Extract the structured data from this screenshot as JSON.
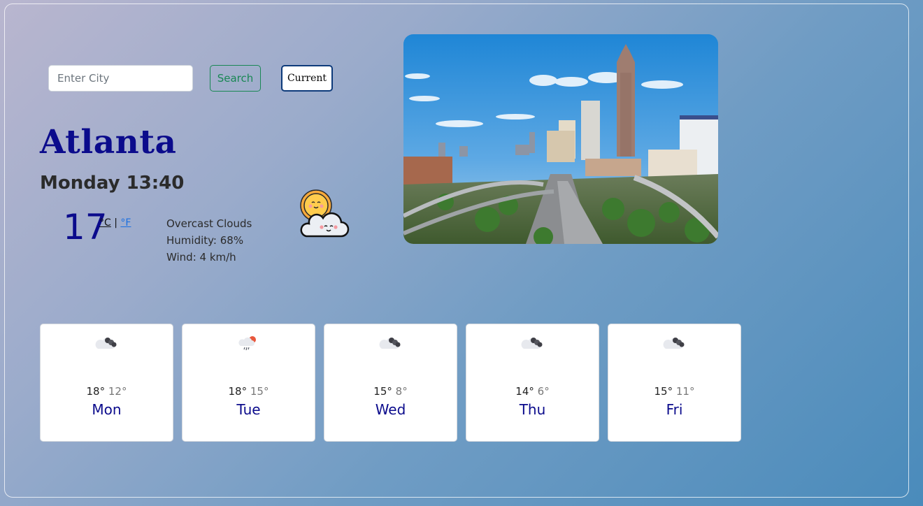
{
  "search": {
    "placeholder": "Enter City",
    "search_label": "Search",
    "current_label": "Current"
  },
  "weather": {
    "city": "Atlanta",
    "datetime": "Monday 13:40",
    "temperature": "17",
    "unit_c": "°C",
    "unit_sep": "|",
    "unit_f": "°F",
    "description": "Overcast Clouds",
    "humidity": "Humidity: 68%",
    "wind": "Wind: 4 km/h",
    "icon": "sun-behind-cloud-icon"
  },
  "forecast": [
    {
      "day": "Mon",
      "high": "18°",
      "low": "12°",
      "icon": "dark-clouds-icon"
    },
    {
      "day": "Tue",
      "high": "18°",
      "low": "15°",
      "icon": "rain-sun-cloud-icon"
    },
    {
      "day": "Wed",
      "high": "15°",
      "low": "8°",
      "icon": "dark-clouds-icon"
    },
    {
      "day": "Thu",
      "high": "14°",
      "low": "6°",
      "icon": "dark-clouds-icon"
    },
    {
      "day": "Fri",
      "high": "15°",
      "low": "11°",
      "icon": "dark-clouds-icon"
    }
  ],
  "colors": {
    "accent_blue": "#0b0b8c",
    "search_green": "#198754",
    "current_border": "#0d3a7a"
  }
}
